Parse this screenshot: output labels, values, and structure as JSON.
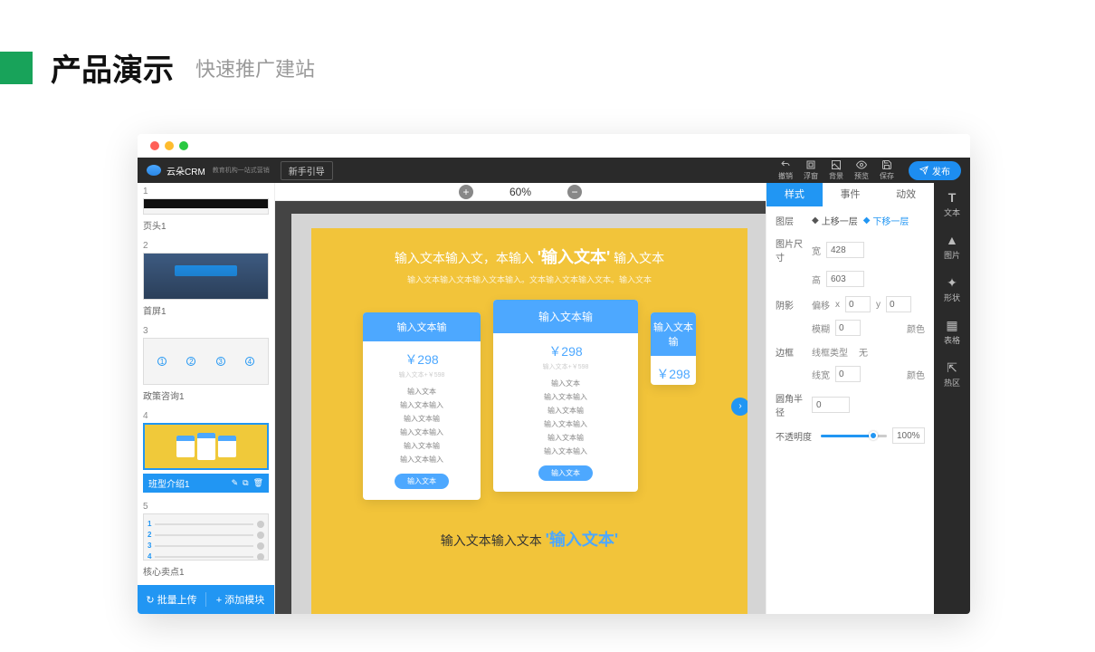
{
  "header": {
    "title": "产品演示",
    "subtitle": "快速推广建站"
  },
  "toolbar": {
    "logo": "云朵CRM",
    "logo_sub": "教育机构一站式营销",
    "guide": "新手引导",
    "undo": "撤销",
    "float": "浮窗",
    "bg": "背景",
    "preview": "预览",
    "save": "保存",
    "publish": "发布"
  },
  "zoom": {
    "value": "60%"
  },
  "pages": [
    {
      "num": "1",
      "label": "页头1"
    },
    {
      "num": "2",
      "label": "首屏1"
    },
    {
      "num": "3",
      "label": "政策咨询1"
    },
    {
      "num": "4",
      "label": "班型介绍1"
    },
    {
      "num": "5",
      "label": "核心卖点1"
    }
  ],
  "left_footer": {
    "upload": "↻ 批量上传",
    "add": "+ 添加模块"
  },
  "canvas": {
    "hero_pre": "输入文本输入文，本输入",
    "hero_big": "'输入文本'",
    "hero_post": "输入文本",
    "hero_sub": "输入文本输入文本输入文本输入。文本输入文本输入文本。输入文本",
    "card": {
      "title": "输入文本输",
      "price": "￥298",
      "price_sub": "输入文本+￥598",
      "lines": [
        "输入文本",
        "输入文本输入",
        "输入文本输",
        "输入文本输入",
        "输入文本输",
        "输入文本输入"
      ],
      "btn": "输入文本"
    },
    "bottom_pre": "输入文本输入文本",
    "bottom_big": "'输入文本'"
  },
  "right": {
    "tabs": {
      "style": "样式",
      "event": "事件",
      "anim": "动效"
    },
    "layer_label": "图层",
    "layer_up": "上移一层",
    "layer_down": "下移一层",
    "size_label": "图片尺寸",
    "w_label": "宽",
    "w_val": "428",
    "h_label": "高",
    "h_val": "603",
    "shadow_label": "阴影",
    "offset_label": "偏移",
    "x_label": "x",
    "x_val": "0",
    "y_label": "y",
    "y_val": "0",
    "blur_label": "模糊",
    "blur_val": "0",
    "color_label": "颜色",
    "border_label": "边框",
    "border_type_label": "线框类型",
    "border_type_val": "无",
    "border_w_label": "线宽",
    "border_w_val": "0",
    "radius_label": "圆角半径",
    "radius_val": "0",
    "opacity_label": "不透明度",
    "opacity_val": "100%"
  },
  "rail": {
    "text": "文本",
    "image": "图片",
    "shape": "形状",
    "table": "表格",
    "hotspot": "热区"
  }
}
